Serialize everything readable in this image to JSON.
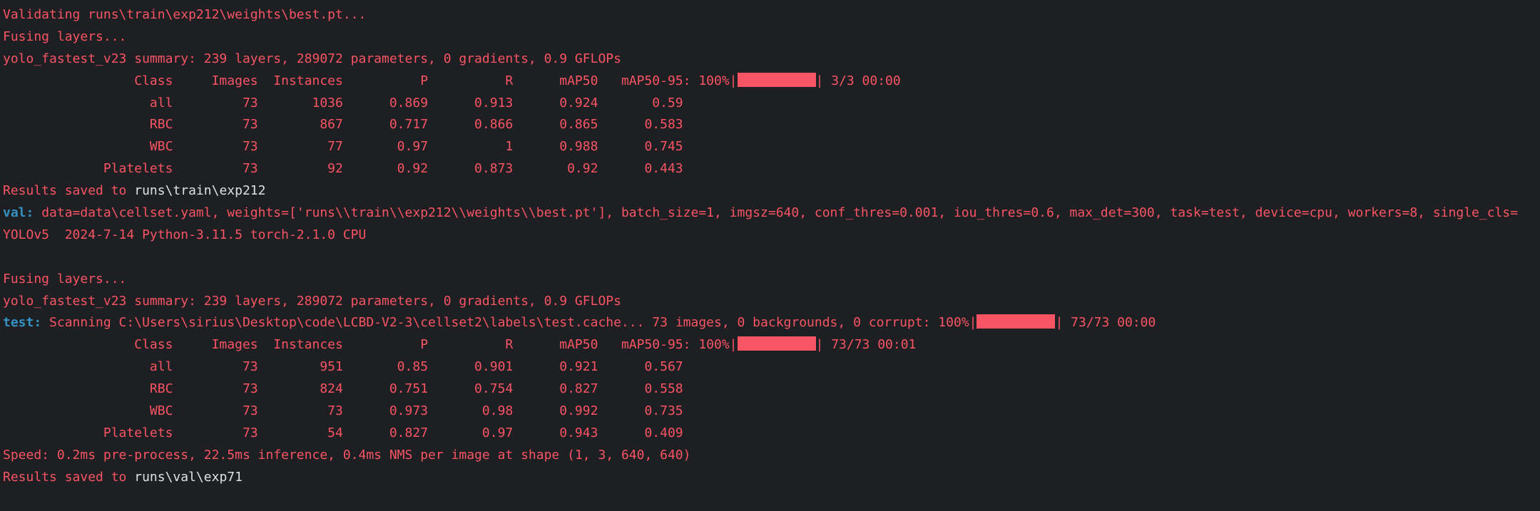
{
  "lines": [
    {
      "text": "Validating runs\\train\\exp212\\weights\\best.pt..."
    },
    {
      "text": "Fusing layers... "
    },
    {
      "text": "yolo_fastest_v23 summary: 239 layers, 289072 parameters, 0 gradients, 0.9 GFLOPs"
    },
    {
      "before": "                 Class     Images  Instances          P          R      mAP50   mAP50-95: 100%|",
      "after": "| 3/3 00:00"
    },
    {
      "text": "                   all         73       1036      0.869      0.913      0.924       0.59"
    },
    {
      "text": "                   RBC         73        867      0.717      0.866      0.865      0.583"
    },
    {
      "text": "                   WBC         73         77       0.97          1      0.988      0.745"
    },
    {
      "text": "             Platelets         73         92       0.92      0.873       0.92      0.443"
    },
    {
      "prefix": "Results saved to ",
      "path": "runs\\train\\exp212"
    },
    {
      "label": "val:",
      "text": " data=data\\cellset.yaml, weights=['runs\\\\train\\\\exp212\\\\weights\\\\best.pt'], batch_size=1, imgsz=640, conf_thres=0.001, iou_thres=0.6, max_det=300, task=test, device=cpu, workers=8, single_cls="
    },
    {
      "text": "YOLOv5  2024-7-14 Python-3.11.5 torch-2.1.0 CPU"
    },
    {
      "text": ""
    },
    {
      "text": "Fusing layers... "
    },
    {
      "text": "yolo_fastest_v23 summary: 239 layers, 289072 parameters, 0 gradients, 0.9 GFLOPs"
    },
    {
      "label": "test:",
      "before": " Scanning C:\\Users\\sirius\\Desktop\\code\\LCBD-V2-3\\cellset2\\labels\\test.cache... 73 images, 0 backgrounds, 0 corrupt: 100%|",
      "after": "| 73/73 00:00"
    },
    {
      "before": "                 Class     Images  Instances          P          R      mAP50   mAP50-95: 100%|",
      "after": "| 73/73 00:01"
    },
    {
      "text": "                   all         73        951       0.85      0.901      0.921      0.567"
    },
    {
      "text": "                   RBC         73        824      0.751      0.754      0.827      0.558"
    },
    {
      "text": "                   WBC         73         73      0.973       0.98      0.992      0.735"
    },
    {
      "text": "             Platelets         73         54      0.827       0.97      0.943      0.409"
    },
    {
      "text": "Speed: 0.2ms pre-process, 22.5ms inference, 0.4ms NMS per image at shape (1, 3, 640, 640)"
    },
    {
      "prefix": "Results saved to ",
      "path": "runs\\val\\exp71"
    }
  ],
  "colors": {
    "background": "#1e1f22",
    "stderr_text": "#f75464",
    "path_text": "#dfe1e5",
    "label_text": "#3592c4"
  }
}
